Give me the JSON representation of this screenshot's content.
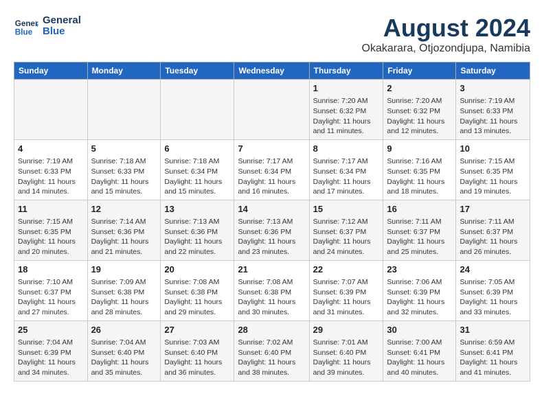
{
  "header": {
    "logo_line1": "General",
    "logo_line2": "Blue",
    "title": "August 2024",
    "subtitle": "Okakarara, Otjozondjupa, Namibia"
  },
  "days_of_week": [
    "Sunday",
    "Monday",
    "Tuesday",
    "Wednesday",
    "Thursday",
    "Friday",
    "Saturday"
  ],
  "weeks": [
    [
      {
        "day": "",
        "info": ""
      },
      {
        "day": "",
        "info": ""
      },
      {
        "day": "",
        "info": ""
      },
      {
        "day": "",
        "info": ""
      },
      {
        "day": "1",
        "info": "Sunrise: 7:20 AM\nSunset: 6:32 PM\nDaylight: 11 hours\nand 11 minutes."
      },
      {
        "day": "2",
        "info": "Sunrise: 7:20 AM\nSunset: 6:32 PM\nDaylight: 11 hours\nand 12 minutes."
      },
      {
        "day": "3",
        "info": "Sunrise: 7:19 AM\nSunset: 6:33 PM\nDaylight: 11 hours\nand 13 minutes."
      }
    ],
    [
      {
        "day": "4",
        "info": "Sunrise: 7:19 AM\nSunset: 6:33 PM\nDaylight: 11 hours\nand 14 minutes."
      },
      {
        "day": "5",
        "info": "Sunrise: 7:18 AM\nSunset: 6:33 PM\nDaylight: 11 hours\nand 15 minutes."
      },
      {
        "day": "6",
        "info": "Sunrise: 7:18 AM\nSunset: 6:34 PM\nDaylight: 11 hours\nand 15 minutes."
      },
      {
        "day": "7",
        "info": "Sunrise: 7:17 AM\nSunset: 6:34 PM\nDaylight: 11 hours\nand 16 minutes."
      },
      {
        "day": "8",
        "info": "Sunrise: 7:17 AM\nSunset: 6:34 PM\nDaylight: 11 hours\nand 17 minutes."
      },
      {
        "day": "9",
        "info": "Sunrise: 7:16 AM\nSunset: 6:35 PM\nDaylight: 11 hours\nand 18 minutes."
      },
      {
        "day": "10",
        "info": "Sunrise: 7:15 AM\nSunset: 6:35 PM\nDaylight: 11 hours\nand 19 minutes."
      }
    ],
    [
      {
        "day": "11",
        "info": "Sunrise: 7:15 AM\nSunset: 6:35 PM\nDaylight: 11 hours\nand 20 minutes."
      },
      {
        "day": "12",
        "info": "Sunrise: 7:14 AM\nSunset: 6:36 PM\nDaylight: 11 hours\nand 21 minutes."
      },
      {
        "day": "13",
        "info": "Sunrise: 7:13 AM\nSunset: 6:36 PM\nDaylight: 11 hours\nand 22 minutes."
      },
      {
        "day": "14",
        "info": "Sunrise: 7:13 AM\nSunset: 6:36 PM\nDaylight: 11 hours\nand 23 minutes."
      },
      {
        "day": "15",
        "info": "Sunrise: 7:12 AM\nSunset: 6:37 PM\nDaylight: 11 hours\nand 24 minutes."
      },
      {
        "day": "16",
        "info": "Sunrise: 7:11 AM\nSunset: 6:37 PM\nDaylight: 11 hours\nand 25 minutes."
      },
      {
        "day": "17",
        "info": "Sunrise: 7:11 AM\nSunset: 6:37 PM\nDaylight: 11 hours\nand 26 minutes."
      }
    ],
    [
      {
        "day": "18",
        "info": "Sunrise: 7:10 AM\nSunset: 6:37 PM\nDaylight: 11 hours\nand 27 minutes."
      },
      {
        "day": "19",
        "info": "Sunrise: 7:09 AM\nSunset: 6:38 PM\nDaylight: 11 hours\nand 28 minutes."
      },
      {
        "day": "20",
        "info": "Sunrise: 7:08 AM\nSunset: 6:38 PM\nDaylight: 11 hours\nand 29 minutes."
      },
      {
        "day": "21",
        "info": "Sunrise: 7:08 AM\nSunset: 6:38 PM\nDaylight: 11 hours\nand 30 minutes."
      },
      {
        "day": "22",
        "info": "Sunrise: 7:07 AM\nSunset: 6:39 PM\nDaylight: 11 hours\nand 31 minutes."
      },
      {
        "day": "23",
        "info": "Sunrise: 7:06 AM\nSunset: 6:39 PM\nDaylight: 11 hours\nand 32 minutes."
      },
      {
        "day": "24",
        "info": "Sunrise: 7:05 AM\nSunset: 6:39 PM\nDaylight: 11 hours\nand 33 minutes."
      }
    ],
    [
      {
        "day": "25",
        "info": "Sunrise: 7:04 AM\nSunset: 6:39 PM\nDaylight: 11 hours\nand 34 minutes."
      },
      {
        "day": "26",
        "info": "Sunrise: 7:04 AM\nSunset: 6:40 PM\nDaylight: 11 hours\nand 35 minutes."
      },
      {
        "day": "27",
        "info": "Sunrise: 7:03 AM\nSunset: 6:40 PM\nDaylight: 11 hours\nand 36 minutes."
      },
      {
        "day": "28",
        "info": "Sunrise: 7:02 AM\nSunset: 6:40 PM\nDaylight: 11 hours\nand 38 minutes."
      },
      {
        "day": "29",
        "info": "Sunrise: 7:01 AM\nSunset: 6:40 PM\nDaylight: 11 hours\nand 39 minutes."
      },
      {
        "day": "30",
        "info": "Sunrise: 7:00 AM\nSunset: 6:41 PM\nDaylight: 11 hours\nand 40 minutes."
      },
      {
        "day": "31",
        "info": "Sunrise: 6:59 AM\nSunset: 6:41 PM\nDaylight: 11 hours\nand 41 minutes."
      }
    ]
  ]
}
